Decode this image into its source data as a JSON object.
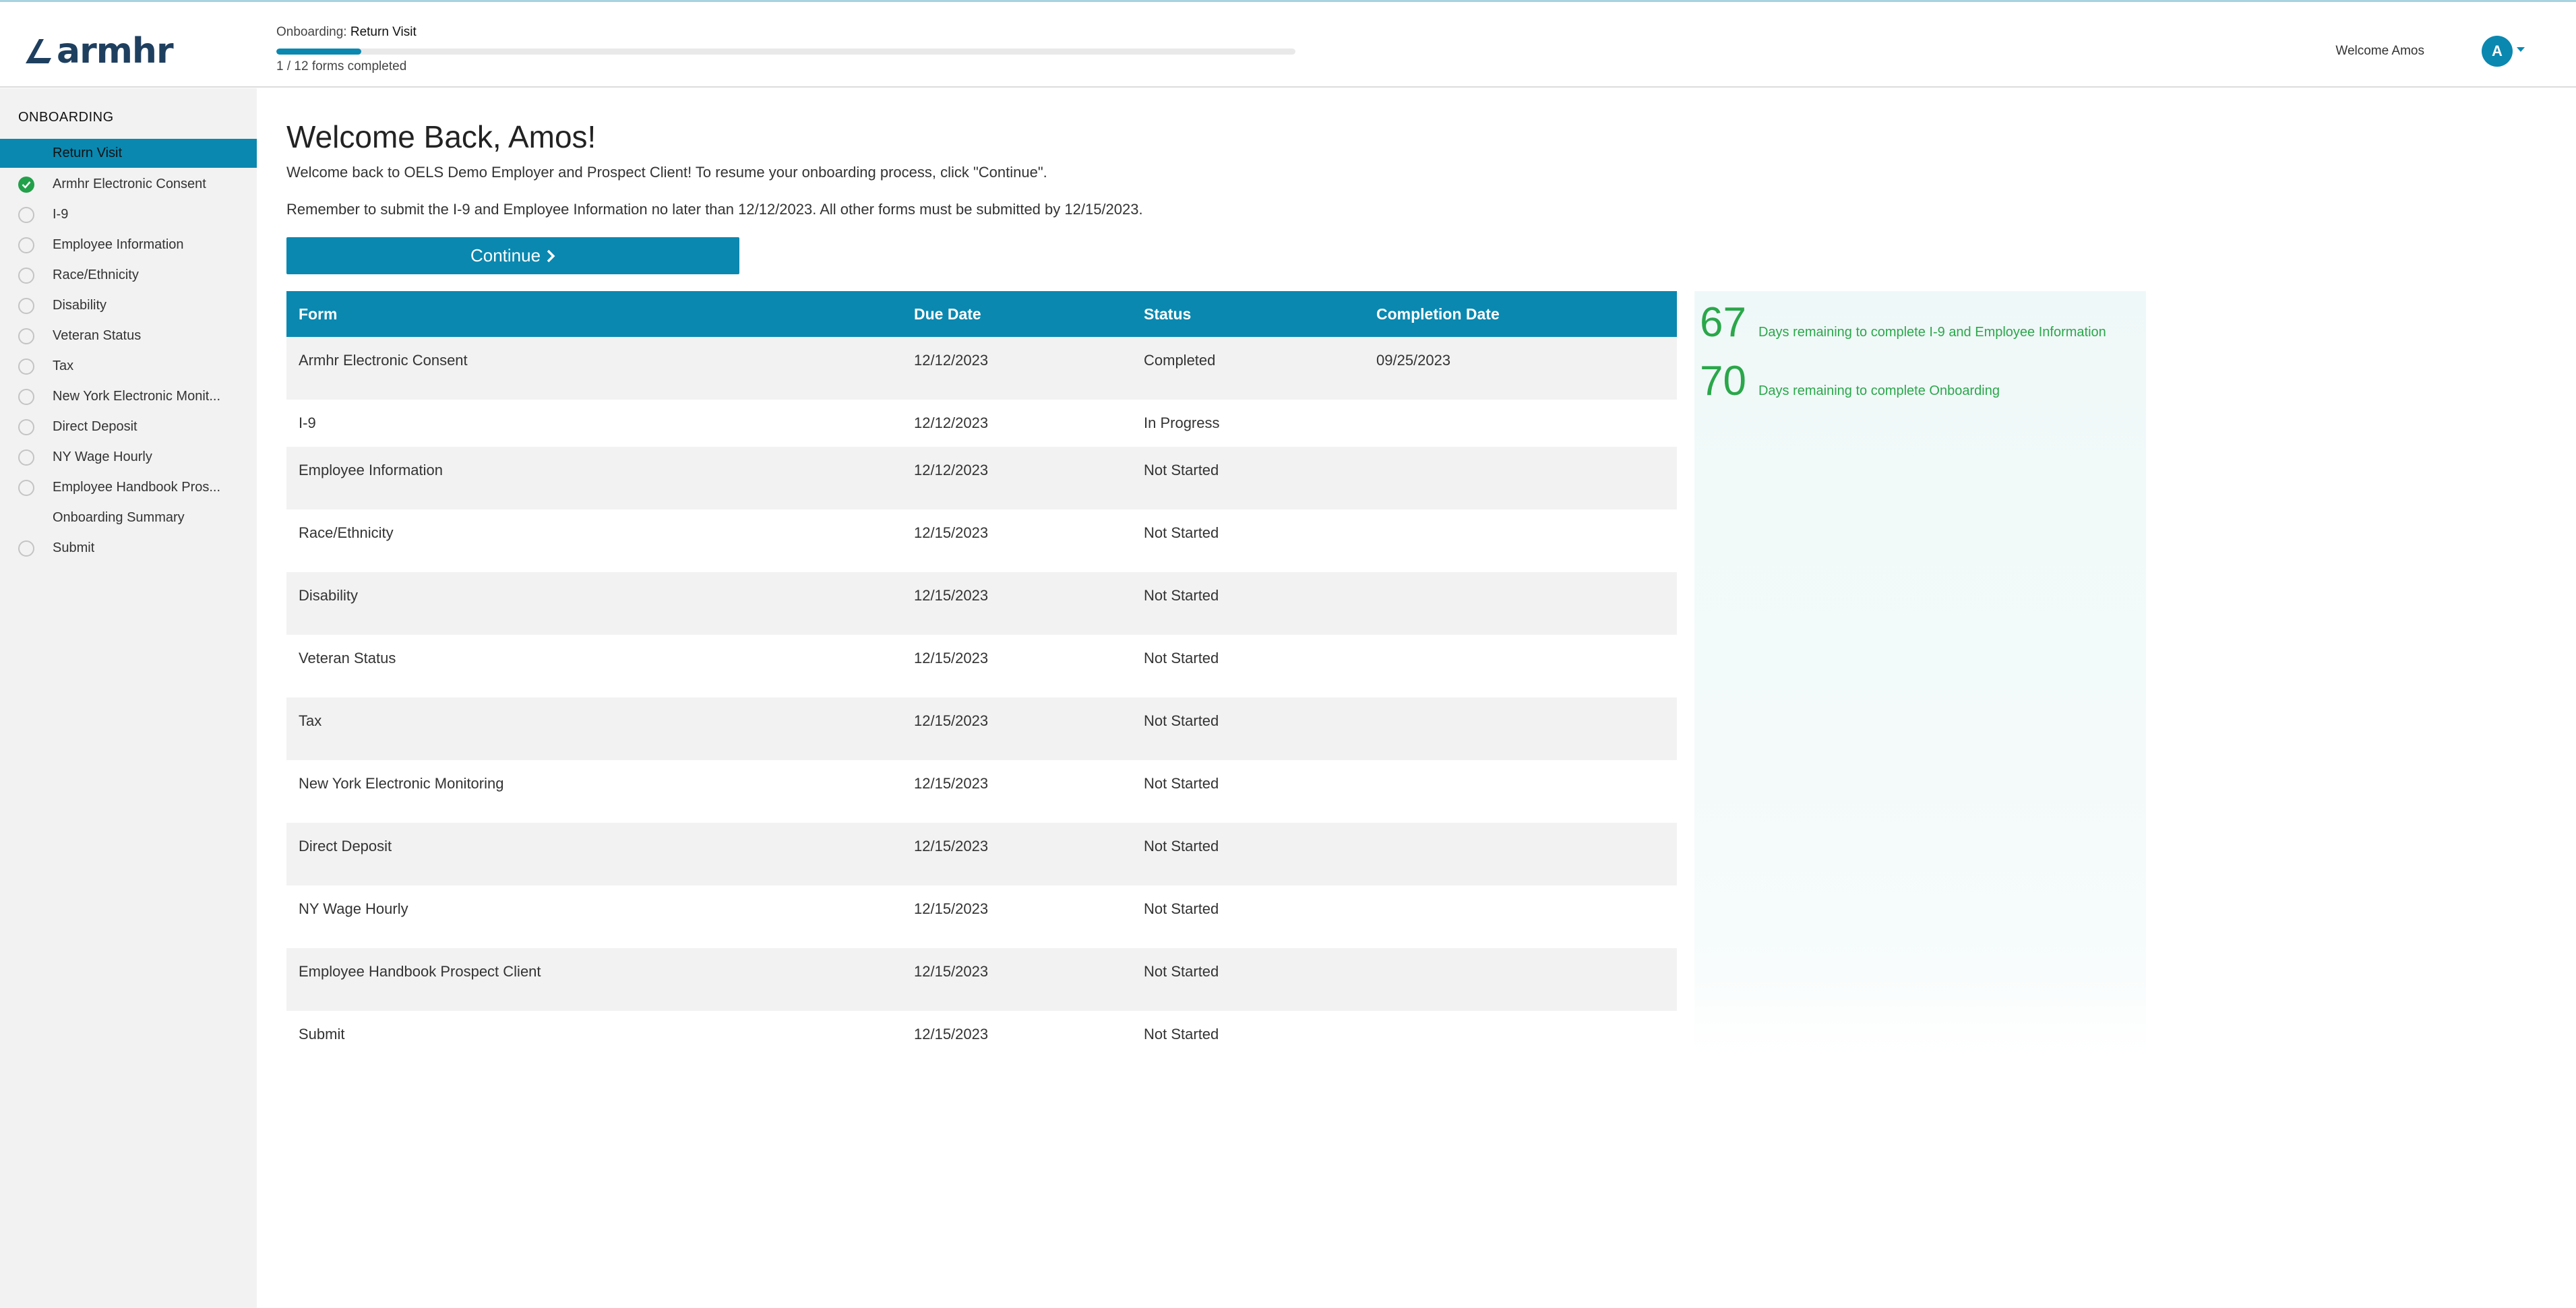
{
  "header": {
    "brand": "armhr",
    "progress_prefix": "Onboarding:",
    "progress_stage": "Return Visit",
    "progress_fraction": 0.0833,
    "progress_count": "1 / 12 forms completed",
    "welcome": "Welcome Amos",
    "avatar_initial": "A"
  },
  "sidebar": {
    "heading": "ONBOARDING",
    "items": [
      {
        "label": "Return Visit",
        "state": "active"
      },
      {
        "label": "Armhr Electronic Consent",
        "state": "done"
      },
      {
        "label": "I-9",
        "state": "todo"
      },
      {
        "label": "Employee Information",
        "state": "todo"
      },
      {
        "label": "Race/Ethnicity",
        "state": "todo"
      },
      {
        "label": "Disability",
        "state": "todo"
      },
      {
        "label": "Veteran Status",
        "state": "todo"
      },
      {
        "label": "Tax",
        "state": "todo"
      },
      {
        "label": "New York Electronic Monit...",
        "state": "todo"
      },
      {
        "label": "Direct Deposit",
        "state": "todo"
      },
      {
        "label": "NY Wage Hourly",
        "state": "todo"
      },
      {
        "label": "Employee Handbook Pros...",
        "state": "todo"
      },
      {
        "label": "Onboarding Summary",
        "state": "none"
      },
      {
        "label": "Submit",
        "state": "todo"
      }
    ]
  },
  "main": {
    "title": "Welcome Back, Amos!",
    "intro": "Welcome back to OELS Demo Employer and Prospect Client! To resume your onboarding process, click \"Continue\".",
    "reminder": "Remember to submit the I-9 and Employee Information no later than 12/12/2023. All other forms must be submitted by 12/15/2023.",
    "continue_label": "Continue",
    "table": {
      "headers": [
        "Form",
        "Due Date",
        "Status",
        "Completion Date"
      ],
      "rows": [
        {
          "form": "Armhr Electronic Consent",
          "due": "12/12/2023",
          "status": "Completed",
          "completed": "09/25/2023"
        },
        {
          "form": "I-9",
          "due": "12/12/2023",
          "status": "In Progress",
          "completed": ""
        },
        {
          "form": "Employee Information",
          "due": "12/12/2023",
          "status": "Not Started",
          "completed": ""
        },
        {
          "form": "Race/Ethnicity",
          "due": "12/15/2023",
          "status": "Not Started",
          "completed": ""
        },
        {
          "form": "Disability",
          "due": "12/15/2023",
          "status": "Not Started",
          "completed": ""
        },
        {
          "form": "Veteran Status",
          "due": "12/15/2023",
          "status": "Not Started",
          "completed": ""
        },
        {
          "form": "Tax",
          "due": "12/15/2023",
          "status": "Not Started",
          "completed": ""
        },
        {
          "form": "New York Electronic Monitoring",
          "due": "12/15/2023",
          "status": "Not Started",
          "completed": ""
        },
        {
          "form": "Direct Deposit",
          "due": "12/15/2023",
          "status": "Not Started",
          "completed": ""
        },
        {
          "form": "NY Wage Hourly",
          "due": "12/15/2023",
          "status": "Not Started",
          "completed": ""
        },
        {
          "form": "Employee Handbook Prospect Client",
          "due": "12/15/2023",
          "status": "Not Started",
          "completed": ""
        },
        {
          "form": "Submit",
          "due": "12/15/2023",
          "status": "Not Started",
          "completed": ""
        }
      ]
    },
    "days": [
      {
        "number": "67",
        "label": "Days remaining to complete I-9 and Employee Information"
      },
      {
        "number": "70",
        "label": "Days remaining to complete Onboarding"
      }
    ]
  },
  "colors": {
    "accent": "#0a88b0",
    "success": "#2aa74a",
    "sidebar_bg": "#f2f2f2",
    "logo": "#1f3f5f"
  }
}
